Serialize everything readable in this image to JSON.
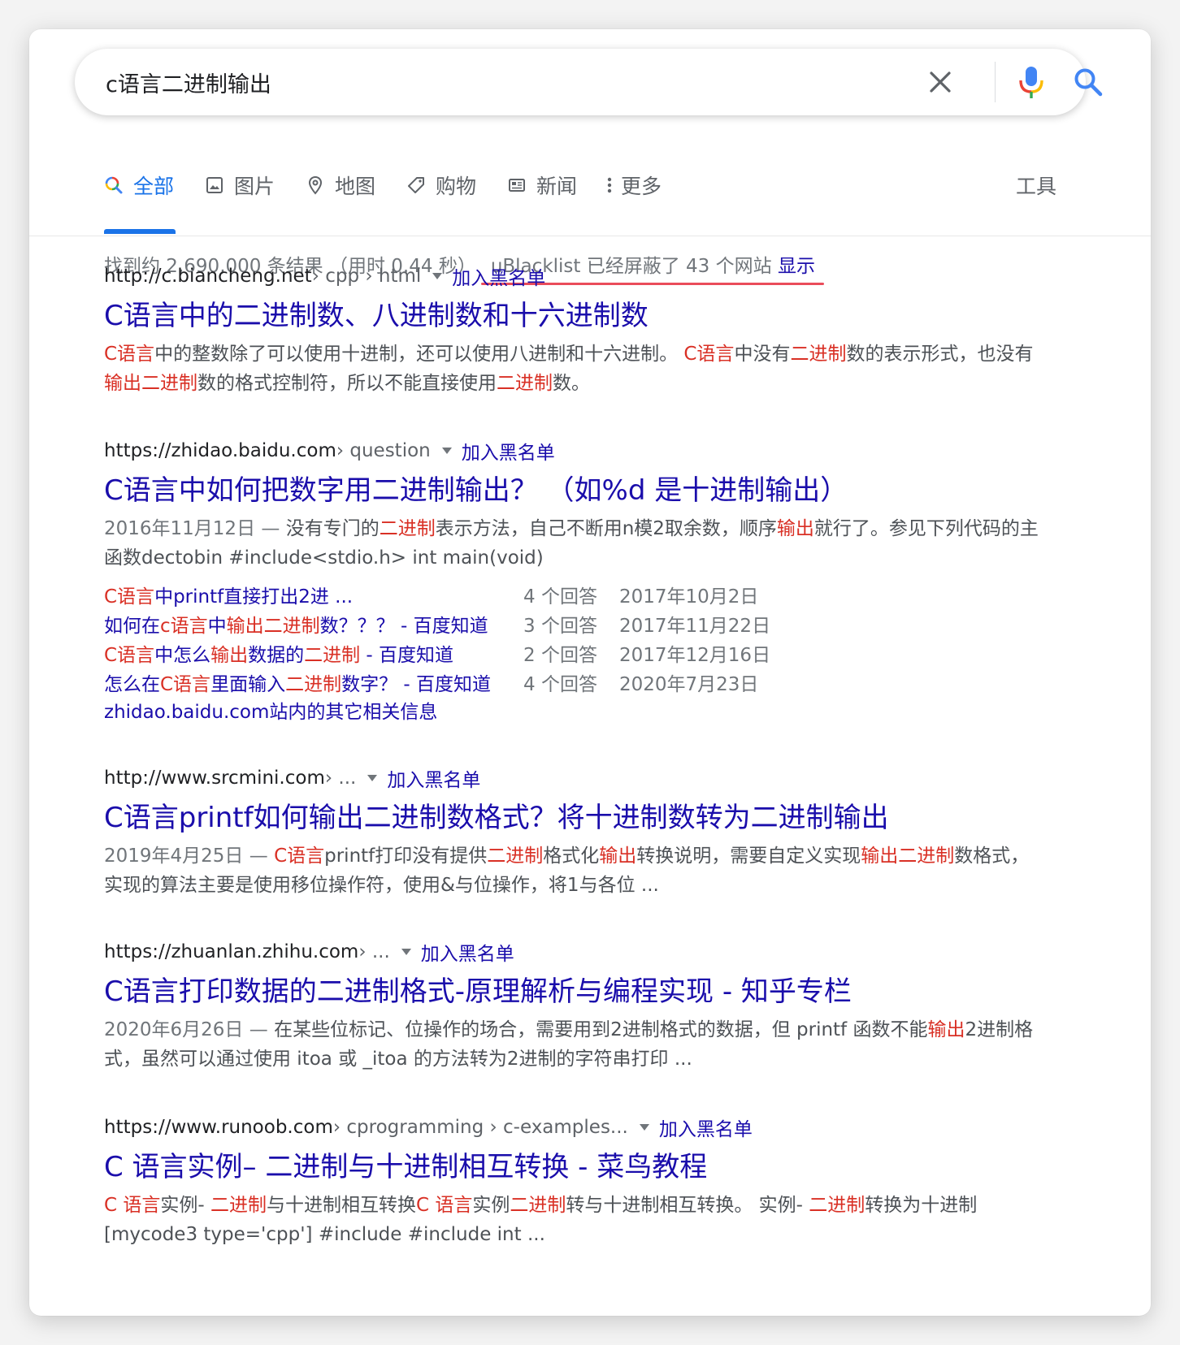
{
  "search": {
    "query": "c语言二进制输出"
  },
  "tabs": [
    {
      "label": "全部",
      "icon": "google-search-icon"
    },
    {
      "label": "图片",
      "icon": "image-icon"
    },
    {
      "label": "地图",
      "icon": "map-pin-icon"
    },
    {
      "label": "购物",
      "icon": "tag-icon"
    },
    {
      "label": "新闻",
      "icon": "newspaper-icon"
    },
    {
      "label": "更多",
      "icon": "more-vert-icon"
    }
  ],
  "tools_label": "工具",
  "stats": {
    "text": "找到约 2,690,000 条结果 （用时 0.44 秒）",
    "ublacklist": "uBlacklist 已经屏蔽了 43 个网站",
    "show_link": "显示"
  },
  "block_label": "加入黑名单",
  "results": [
    {
      "site": "http://c.biancheng.net",
      "path": " › cpp › html",
      "title": "C语言中的二进制数、八进制数和十六进制数",
      "snippet": [
        {
          "t": "C语言",
          "h": true
        },
        {
          "t": "中的整数除了可以使用十进制，还可以使用八进制和十六进制。 "
        },
        {
          "t": "C语言",
          "h": true
        },
        {
          "t": "中没有"
        },
        {
          "t": "二进制",
          "h": true
        },
        {
          "t": "数的表示形式，也没有"
        },
        {
          "t": "输出二进制",
          "h": true
        },
        {
          "t": "数的格式控制符，所以不能直接使用"
        },
        {
          "t": "二进制",
          "h": true
        },
        {
          "t": "数。"
        }
      ]
    },
    {
      "site": "https://zhidao.baidu.com",
      "path": " › question",
      "title": "C语言中如何把数字用二进制输出？ （如%d 是十进制输出）",
      "date": "2016年11月12日 — ",
      "snippet": [
        {
          "t": "没有专门的"
        },
        {
          "t": "二进制",
          "h": true
        },
        {
          "t": "表示方法，自己不断用n模2取余数，顺序"
        },
        {
          "t": "输出",
          "h": true
        },
        {
          "t": "就行了。参见下列代码的主函数dectobin #include<stdio.h> int main(void)"
        }
      ],
      "sublinks": [
        {
          "parts": [
            {
              "t": "C语言",
              "h": true
            },
            {
              "t": "中printf直接打出2进 ..."
            }
          ],
          "answers": "4 个回答",
          "date": "2017年10月2日"
        },
        {
          "parts": [
            {
              "t": "如何在"
            },
            {
              "t": "c语言",
              "h": true
            },
            {
              "t": "中"
            },
            {
              "t": "输出二进制",
              "h": true
            },
            {
              "t": "数？？？ - 百度知道"
            }
          ],
          "answers": "3 个回答",
          "date": "2017年11月22日"
        },
        {
          "parts": [
            {
              "t": "C语言",
              "h": true
            },
            {
              "t": "中怎么"
            },
            {
              "t": "输出",
              "h": true
            },
            {
              "t": "数据的"
            },
            {
              "t": "二进制",
              "h": true
            },
            {
              "t": " - 百度知道"
            }
          ],
          "answers": "2 个回答",
          "date": "2017年12月16日"
        },
        {
          "parts": [
            {
              "t": "怎么在"
            },
            {
              "t": "C语言",
              "h": true
            },
            {
              "t": "里面输入"
            },
            {
              "t": "二进制",
              "h": true
            },
            {
              "t": "数字？ - 百度知道"
            }
          ],
          "answers": "4 个回答",
          "date": "2020年7月23日"
        }
      ],
      "more": "zhidao.baidu.com站内的其它相关信息"
    },
    {
      "site": "http://www.srcmini.com",
      "path": " › ...",
      "title": "C语言printf如何输出二进制数格式？将十进制数转为二进制输出",
      "date": "2019年4月25日 — ",
      "snippet": [
        {
          "t": "C语言",
          "h": true
        },
        {
          "t": "printf打印没有提供"
        },
        {
          "t": "二进制",
          "h": true
        },
        {
          "t": "格式化"
        },
        {
          "t": "输出",
          "h": true
        },
        {
          "t": "转换说明，需要自定义实现"
        },
        {
          "t": "输出二进制",
          "h": true
        },
        {
          "t": "数格式，实现的算法主要是使用移位操作符，使用&与位操作，将1与各位 ..."
        }
      ]
    },
    {
      "site": "https://zhuanlan.zhihu.com",
      "path": " › ...",
      "title": "C语言打印数据的二进制格式-原理解析与编程实现 - 知乎专栏",
      "date": "2020年6月26日 — ",
      "snippet": [
        {
          "t": "在某些位标记、位操作的场合，需要用到2进制格式的数据，但 printf 函数不能"
        },
        {
          "t": "输出",
          "h": true
        },
        {
          "t": "2进制格式，虽然可以通过使用 itoa 或 _itoa 的方法转为2进制的字符串打印 ..."
        }
      ]
    },
    {
      "site": "https://www.runoob.com",
      "path": " › cprogramming › c-examples...",
      "title": "C 语言实例– 二进制与十进制相互转换 - 菜鸟教程",
      "snippet": [
        {
          "t": "C 语言",
          "h": true
        },
        {
          "t": "实例- "
        },
        {
          "t": "二进制",
          "h": true
        },
        {
          "t": "与十进制相互转换"
        },
        {
          "t": "C 语言",
          "h": true
        },
        {
          "t": "实例"
        },
        {
          "t": "二进制",
          "h": true
        },
        {
          "t": "转与十进制相互转换。 实例- "
        },
        {
          "t": "二进制",
          "h": true
        },
        {
          "t": "转换为十进制[mycode3 type='cpp'] #include #include int ..."
        }
      ]
    }
  ]
}
